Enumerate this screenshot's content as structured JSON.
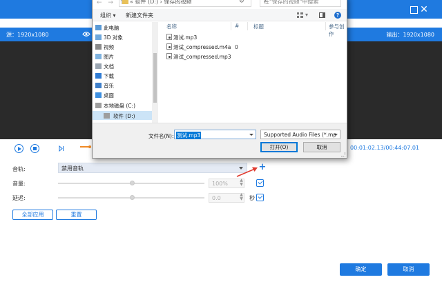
{
  "app": {
    "source_label": "源：1920x1080",
    "output_label": "输出：1920x1080",
    "time_current": "00:01:02.13",
    "time_separator": "/",
    "time_total": "00:44:07.01",
    "audio_track_label": "音轨:",
    "audio_track_value": "禁用音轨",
    "add_track_symbol": "+",
    "volume_label": "音量:",
    "volume_value": "100%",
    "delay_label": "延迟:",
    "delay_value": "0.0",
    "delay_unit": "秒",
    "apply_all_label": "全部应用",
    "reset_label": "重置",
    "ok_label": "确定",
    "cancel_label": "取消",
    "accent_color": "#1f7ae0"
  },
  "dialog": {
    "address_text": "« 软件 (D:) › 保存的视频",
    "search_placeholder": "在\"保存的视频\"中搜索",
    "toolbar_organize": "组织 ▾",
    "toolbar_new_folder": "新建文件夹",
    "help_symbol": "?",
    "nav_items": [
      {
        "label": "此电脑",
        "icon": "computer-icon"
      },
      {
        "label": "3D 对象",
        "icon": "3d-objects-icon"
      },
      {
        "label": "视频",
        "icon": "videos-icon"
      },
      {
        "label": "图片",
        "icon": "pictures-icon"
      },
      {
        "label": "文档",
        "icon": "documents-icon"
      },
      {
        "label": "下载",
        "icon": "downloads-icon"
      },
      {
        "label": "音乐",
        "icon": "music-icon"
      },
      {
        "label": "桌面",
        "icon": "desktop-icon"
      },
      {
        "label": "本地磁盘 (C:)",
        "icon": "drive-icon"
      },
      {
        "label": "软件 (D:)",
        "icon": "drive-icon"
      }
    ],
    "columns": [
      "名称",
      "#",
      "标题",
      "参与创作"
    ],
    "files": [
      {
        "name": "测试.mp3",
        "num": ""
      },
      {
        "name": "测试_compressed.m4a",
        "num": "0"
      },
      {
        "name": "测试_compressed.mp3",
        "num": ""
      }
    ],
    "filename_label": "文件名(N):",
    "filename_value": "测试.mp3",
    "filetype_value": "Supported Audio Files (*.mp",
    "open_label": "打开(O)",
    "cancel_label": "取消"
  }
}
